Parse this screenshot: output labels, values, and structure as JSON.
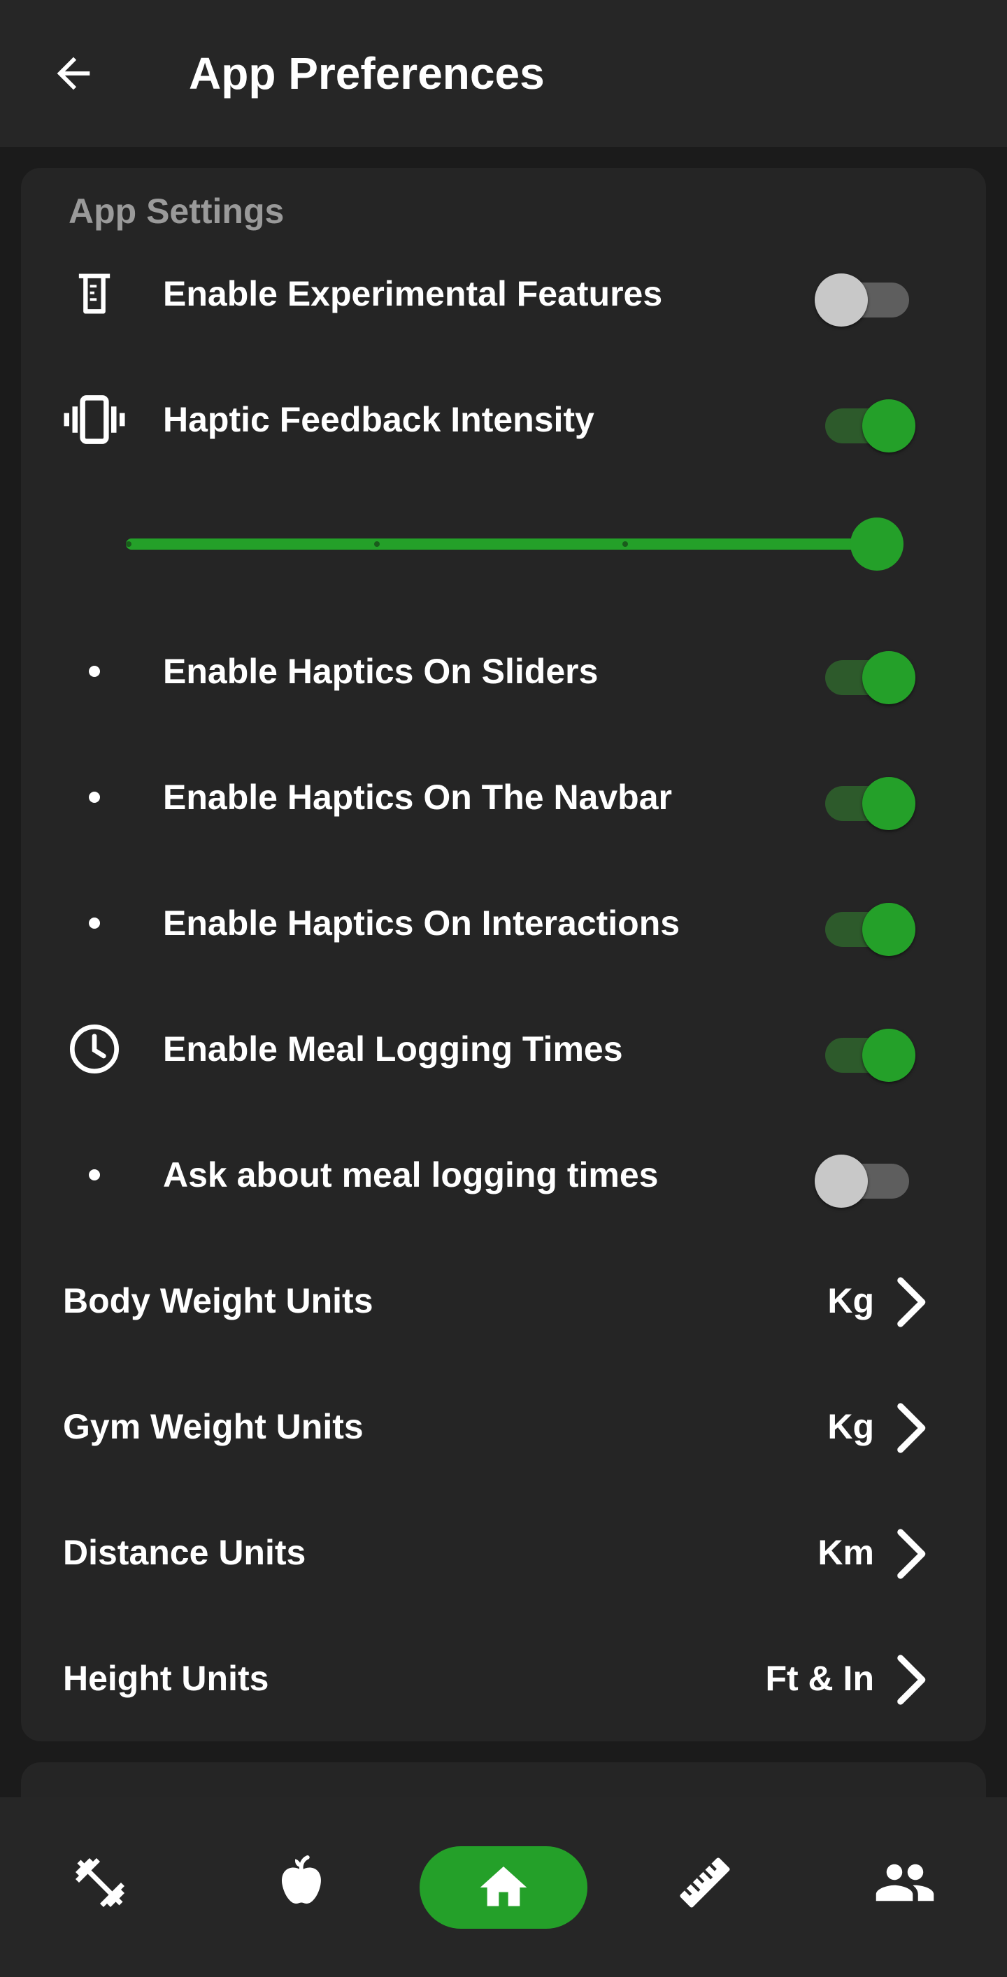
{
  "header": {
    "title": "App Preferences"
  },
  "section": {
    "title": "App Settings"
  },
  "settings": {
    "experimental": {
      "label": "Enable Experimental Features",
      "enabled": false
    },
    "haptic": {
      "label": "Haptic Feedback Intensity",
      "enabled": true,
      "intensity_level": 4,
      "intensity_max": 4
    },
    "haptics_sliders": {
      "label": "Enable Haptics On Sliders",
      "enabled": true
    },
    "haptics_navbar": {
      "label": "Enable Haptics On The Navbar",
      "enabled": true
    },
    "haptics_interactions": {
      "label": "Enable Haptics On Interactions",
      "enabled": true
    },
    "meal_times": {
      "label": "Enable Meal Logging Times",
      "enabled": true
    },
    "ask_meal_times": {
      "label": "Ask about meal logging times",
      "enabled": false
    }
  },
  "units": {
    "body_weight": {
      "label": "Body Weight Units",
      "value": "Kg"
    },
    "gym_weight": {
      "label": "Gym Weight Units",
      "value": "Kg"
    },
    "distance": {
      "label": "Distance Units",
      "value": "Km"
    },
    "height": {
      "label": "Height Units",
      "value": "Ft & In"
    }
  },
  "navbar": {
    "items": [
      {
        "icon": "dumbbell-icon",
        "active": false
      },
      {
        "icon": "apple-icon",
        "active": false
      },
      {
        "icon": "home-icon",
        "active": true
      },
      {
        "icon": "ruler-icon",
        "active": false
      },
      {
        "icon": "people-icon",
        "active": false
      }
    ]
  },
  "colors": {
    "accent": "#24a029",
    "toggle_track_on": "#2d5a2b",
    "toggle_off_thumb": "#c8c8c8",
    "background": "#1b1b1b",
    "card": "#252525",
    "section_title": "#9a9a9a"
  }
}
